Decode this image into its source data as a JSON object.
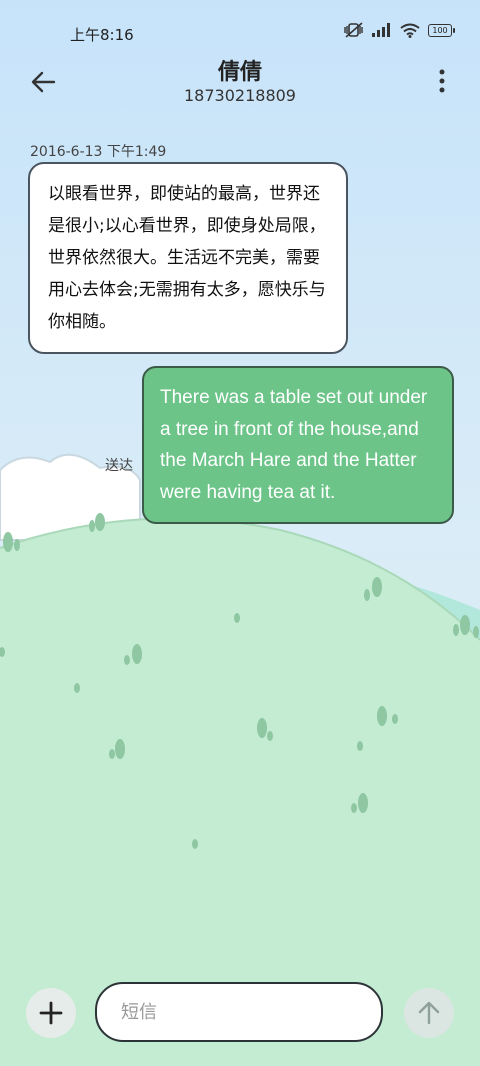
{
  "status_bar": {
    "time": "上午8:16",
    "battery": "100",
    "icons": [
      "mute-vibrate-icon",
      "signal-icon",
      "wifi-icon",
      "battery-icon"
    ]
  },
  "header": {
    "contact_name": "倩倩",
    "phone_number": "18730218809",
    "icons": [
      "back-arrow-icon",
      "more-vertical-icon"
    ]
  },
  "conversation": {
    "timestamp": "2016-6-13 下午1:49",
    "incoming_message": "以眼看世界，即使站的最高，世界还是很小;以心看世界，即使身处局限，世界依然很大。生活远不完美，需要用心去体会;无需拥有太多，愿快乐与你相随。",
    "outgoing_message": "There was a table set out under a tree in front of the house,and the March Hare and the Hatter were having tea at it.",
    "outgoing_status": "送达"
  },
  "compose": {
    "placeholder": "短信",
    "icons": [
      "add-icon",
      "send-arrow-icon"
    ]
  },
  "colors": {
    "sky": "#cde8fb",
    "hill": "#c6ecd3",
    "outgoing_bubble": "#6cc489",
    "incoming_bubble": "#ffffff"
  }
}
